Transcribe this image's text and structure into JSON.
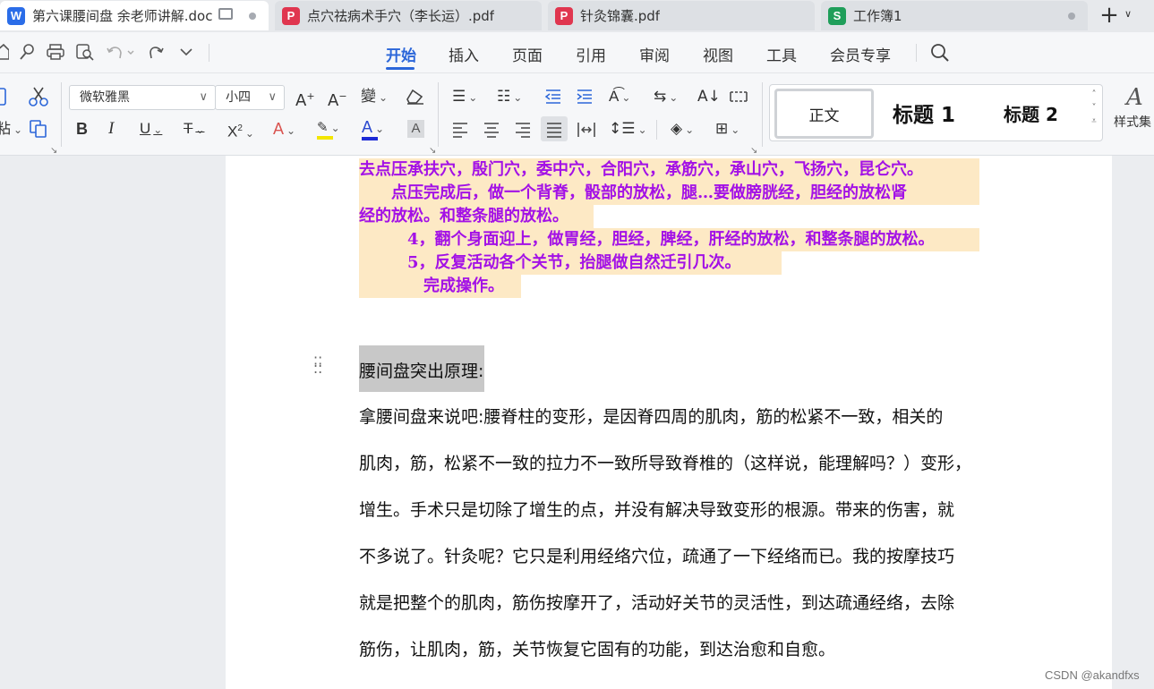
{
  "tabs": [
    {
      "title": "第六课腰间盘 余老师讲解.doc",
      "app": "W",
      "app_color": "#2b6de8",
      "active": true
    },
    {
      "title": "点穴祛病术手穴（李长运）.pdf",
      "app": "P",
      "app_color": "#e0364f",
      "active": false
    },
    {
      "title": "针灸锦囊.pdf",
      "app": "P",
      "app_color": "#e0364f",
      "active": false
    },
    {
      "title": "工作簿1",
      "app": "S",
      "app_color": "#1f9e5a",
      "active": false
    }
  ],
  "tab_add": "+",
  "menu": {
    "items": [
      "开始",
      "插入",
      "页面",
      "引用",
      "审阅",
      "视图",
      "工具",
      "会员专享"
    ],
    "active_index": 0,
    "accent_color": "#2b66d9"
  },
  "ribbon": {
    "font_name": "微软雅黑",
    "font_size": "小四",
    "paste_label": "粘",
    "styles": {
      "normal": "正文",
      "heading1": "标题  1",
      "heading2": "标题  2",
      "style_set_label": "样式集"
    }
  },
  "document": {
    "highlight_color": "#fde9c5",
    "highlight_text_color": "#a311e6",
    "highlighted_lines": [
      "去点压承扶穴，殷门穴，委中穴，合阳穴，承筋穴，承山穴，飞扬穴，昆仑穴。",
      "　　点压完成后，做一个背脊，骰部的放松，腿…要做膀胱经，胆经的放松肾",
      "经的放松。和整条腿的放松。",
      "　　　4，翻个身面迎上，做胃经，胆经，脾经，肝经的放松，和整条腿的放松。",
      "　　　5，反复活动各个关节，抬腿做自然迁引几次。",
      "　　　　完成操作。"
    ],
    "heading": "腰间盘突出原理:",
    "paragraph_lines": [
      "拿腰间盘来说吧:腰脊柱的变形，是因脊四周的肌肉，筋的松紧不一致，相关的",
      "肌肉，筋，松紧不一致的拉力不一致所导致脊椎的（这样说，能理解吗？）变形，",
      "增生。手术只是切除了增生的点，并没有解决导致变形的根源。带来的伤害，就",
      "不多说了。针灸呢？它只是利用经络穴位，疏通了一下经络而已。我的按摩技巧",
      "就是把整个的肌肉，筋伤按摩开了，活动好关节的灵活性，到达疏通经络，去除",
      "筋伤，让肌肉，筋，关节恢复它固有的功能，到达治愈和自愈。"
    ]
  },
  "watermark": "CSDN @akandfxs"
}
